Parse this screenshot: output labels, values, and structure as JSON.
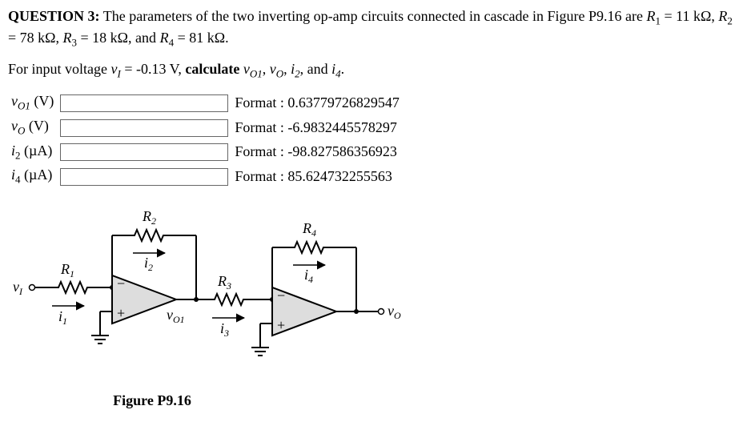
{
  "question": {
    "label": "QUESTION 3:",
    "body1": "The parameters of the two inverting op-amp circuits connected in cascade in Figure P9.16 are ",
    "R1_name": "R",
    "R1_sub": "1",
    "eq": " = ",
    "R1_val": "11 kΩ, ",
    "R2_name": "R",
    "R2_sub": "2",
    "R2_val": " = 78 kΩ, ",
    "R3_name": "R",
    "R3_sub": "3",
    "R3_val": " = 18 kΩ, and ",
    "R4_name": "R",
    "R4_sub": "4",
    "R4_val": " = 81 kΩ."
  },
  "prompt": {
    "p1": "For input voltage ",
    "vI": "v",
    "vI_sub": "I",
    "vI_val": " = -0.13 V, ",
    "calc": "calculate ",
    "t1": "v",
    "t1s": "O1",
    "c1": ", ",
    "t2": "v",
    "t2s": "O",
    "c2": ", ",
    "t3": "i",
    "t3s": "2",
    "c3": ", and ",
    "t4": "i",
    "t4s": "4",
    "c4": "."
  },
  "rows": [
    {
      "sym": "v",
      "sub": "O1",
      "unit": " (V)",
      "fmt": "Format : 0.63779726829547"
    },
    {
      "sym": "v",
      "sub": "O",
      "unit": " (V)",
      "fmt": "Format : -6.9832445578297"
    },
    {
      "sym": "i",
      "sub": "2",
      "unit": " (µA)",
      "fmt": "Format : -98.827586356923"
    },
    {
      "sym": "i",
      "sub": "4",
      "unit": " (µA)",
      "fmt": "Format : 85.624732255563"
    }
  ],
  "fig": {
    "caption": "Figure P9.16",
    "labels": {
      "R1": "R",
      "R1s": "1",
      "R2": "R",
      "R2s": "2",
      "R3": "R",
      "R3s": "3",
      "R4": "R",
      "R4s": "4",
      "vI": "v",
      "vIs": "I",
      "vO1": "v",
      "vO1s": "O1",
      "vO": "v",
      "vOs": "O",
      "i1": "i",
      "i1s": "1",
      "i2": "i",
      "i2s": "2",
      "i3": "i",
      "i3s": "3",
      "i4": "i",
      "i4s": "4",
      "minus": "−",
      "plus": "+",
      "node": "○"
    }
  }
}
